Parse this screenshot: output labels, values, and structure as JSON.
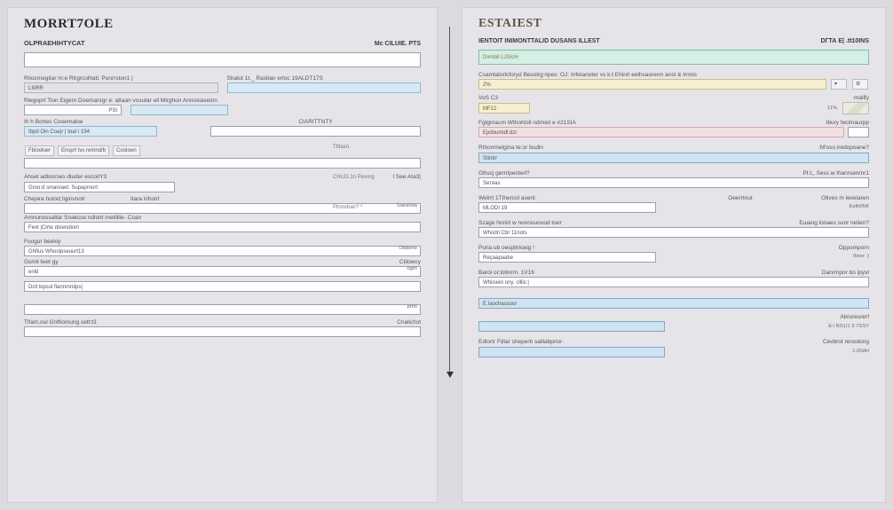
{
  "left": {
    "title": "MORRT7OLE",
    "subhead_left": "OLPRАЕНIНТYСАТ",
    "subhead_right": "Mc CILUIE. PTS",
    "field1_value": "",
    "row2": {
      "a_label": "Rtiocmegitar m:e Rlrgrcolhatl. Punrrston1 |",
      "a_value": "LIIIRR",
      "b_label": "Shalut 1t._ Rastian ertoc 19ALDT17S",
      "b_value": ""
    },
    "row3": {
      "label": "Rlegoprt Tion Eigern Doemanrgr e: attaan vosutar ell Mirghоn Annosiaseinn",
      "value": "PSI",
      "pair_right_value": "",
      "side": "Ttltasn."
    },
    "row4": {
      "a_label": "Ih h      Bortes Cooemaloe",
      "a_value": "Ibpd Oin Coa)r | toat i 194",
      "b_label": "CIARITTNTY",
      "b_value": "",
      "side": "CHLEL1n Pexorg"
    },
    "tabs": {
      "a": "Fbiooluer",
      "b": "Ensprl tvs remnd/b",
      "c": "Cootoen",
      "side": "Plronduer? *"
    },
    "input_below_tabs": "",
    "row6": {
      "a_label": "Ahset adloorses dluder escoitY3",
      "a_value": "Groo:d smanraet: Supaprnort",
      "b_label": "I  See Ata3|"
    },
    "row7": {
      "a_label": "Chejяra hutod;!iginvnotr",
      "b_label": "Itara irihoirt",
      "value": "",
      "right_tiny": "Satrarwa"
    },
    "row8": {
      "label": "Amnunossaltar Snakcce ndloirt melililie- Coan",
      "value": "Fext |Ctrte doiendiom"
    },
    "row9": {
      "label": "Foogur beeloy",
      "value": "Ghflus Whoolpseuurt13",
      "right_tiny": "Obdone"
    },
    "row10": {
      "label": "Gsmil lwet gy",
      "value": "enld",
      "right_label": "Ctilowcy",
      "right_tiny": "ogrn"
    },
    "row11": {
      "value": "Dcll lopcul flannmnlips|",
      "right_tiny": "prtin"
    },
    "row12": {
      "label": "Tlfam,oul Gnftiomung sett:t3",
      "value": "",
      "right_label": "Cnalichst"
    },
    "float_g5": "gr_5 ."
  },
  "right": {
    "title": "ESTAIEST",
    "subhead_left": "IENTOIT INIМONТТАLID DUSANS ILLEST",
    "subhead_right": "DГТА E| .tt10INS",
    "field1_value": "Dvrrioll LJSIcH",
    "row2": {
      "label": "Csamtalorlcforyd Besolrg:прes: OJ: Infetanoter vs k:t Ehlnrl eelhsaorerm anst & lrnnis",
      "value": "2%",
      "icons": true
    },
    "row3": {
      "label_left": "VoS C3",
      "label_right": "mallfy",
      "value_left": "MF12",
      "value_right": "11%",
      "micro": true
    },
    "row4": {
      "label_left": "Fgtgmaum Wthohtsll ndrniet e   #21SIA",
      "label_right": "Ibury fисlmaurpр",
      "value": "Epdoumidl:dzr"
    },
    "row5": {
      "label_left": "Rthonmetgina te:or budin",
      "label_right": ":M'oso iredopoane?",
      "value": "Stintrr"
    },
    "row6": {
      "label_left": "Gfrucj gerrripenterl?",
      "label_right": "PI:t,, Sess м Ihanrsenrnr1",
      "value": "Sетяаs"
    },
    "row7": {
      "label_left": "Welrrt 1TIhercol asenl:",
      "mid_label": "Oeerrtnut",
      "label_right": "Otives m levelаren",
      "value_left": "MLODI 19",
      "value_right": "Esfb0N¢"
    },
    "row8": {
      "label_left": "Szage hnnirl w nonnounood toет",
      "label_right": "Ешang lonaes sunr nelien?",
      "value": "Whodri Cbr 11nots"
    },
    "row9": {
      "label_left": "Рoria ub oespitrioeig !",
      "label_right": "Oppomporn",
      "value_left": "Reçaapaabe",
      "value_right": "thioe :)"
    },
    "row10": {
      "label_left": "Barol or;lotinrm.  1V16",
      "label_right": "Danrmрor bo iрyst",
      "value": "Whioзen ony. clllis:|"
    },
    "row11": {
      "value": "E.Iaochassoor"
    },
    "row12": {
      "label_left": "",
      "label_right": "Abruresrerf",
      "value": "",
      "right_tiny": "E:/ BS1/1 9 7SSY"
    },
    "row13": {
      "label_left": "Edlortr Fdlar shepеrb saillabprior·",
      "label_right": "Cevbrot renodong",
      "value": "",
      "right_tiny": "1,00dH"
    }
  }
}
